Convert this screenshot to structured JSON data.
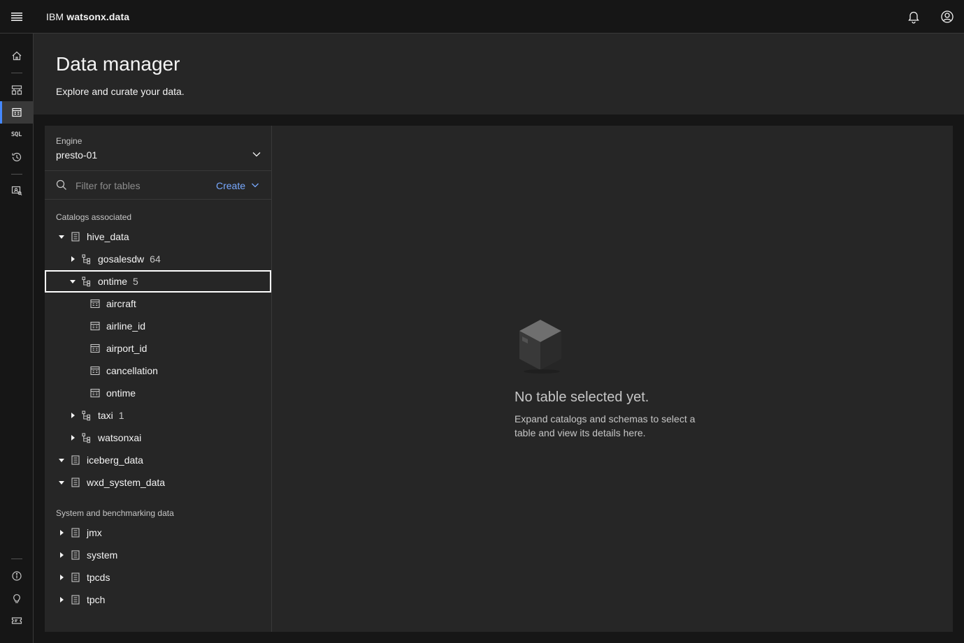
{
  "topbar": {
    "brand_prefix": "IBM",
    "brand_name": "watsonx.data",
    "menu_icon": "hamburger-menu-icon",
    "notifications_icon": "bell-icon",
    "profile_icon": "user-avatar-icon"
  },
  "rail": {
    "items": [
      {
        "name": "home",
        "icon": "home-icon"
      },
      {
        "name": "infrastructure",
        "icon": "infrastructure-icon"
      },
      {
        "name": "data-manager",
        "icon": "table-icon",
        "active": true
      },
      {
        "name": "query-workspace",
        "icon": "sql-icon",
        "text": "SQL"
      },
      {
        "name": "query-history",
        "icon": "history-icon"
      },
      {
        "name": "access-control",
        "icon": "access-control-icon"
      },
      {
        "name": "about",
        "icon": "info-icon"
      },
      {
        "name": "tips",
        "icon": "lightbulb-icon"
      },
      {
        "name": "tickets",
        "icon": "ticket-icon"
      }
    ]
  },
  "header": {
    "title": "Data manager",
    "subtitle": "Explore and curate your data."
  },
  "engine": {
    "label": "Engine",
    "value": "presto-01"
  },
  "filter": {
    "placeholder": "Filter for tables",
    "create_label": "Create"
  },
  "catalogs": {
    "section_label": "Catalogs associated",
    "hive_data": "hive_data",
    "gosalesdw": "gosalesdw",
    "gosalesdw_count": "64",
    "ontime_schema": "ontime",
    "ontime_count": "5",
    "tables": [
      "aircraft",
      "airline_id",
      "airport_id",
      "cancellation",
      "ontime"
    ],
    "taxi": "taxi",
    "taxi_count": "1",
    "watsonxai": "watsonxai",
    "iceberg_data": "iceberg_data",
    "wxd_system_data": "wxd_system_data"
  },
  "system": {
    "section_label": "System and benchmarking data",
    "items": [
      "jmx",
      "system",
      "tpcds",
      "tpch"
    ]
  },
  "empty_state": {
    "title": "No table selected yet.",
    "description": "Expand catalogs and schemas to select a table and view its details here.",
    "illustration": "box-icon"
  },
  "colors": {
    "accent": "#4589ff",
    "link": "#78a9ff",
    "background": "#161616",
    "layer": "#262626"
  }
}
